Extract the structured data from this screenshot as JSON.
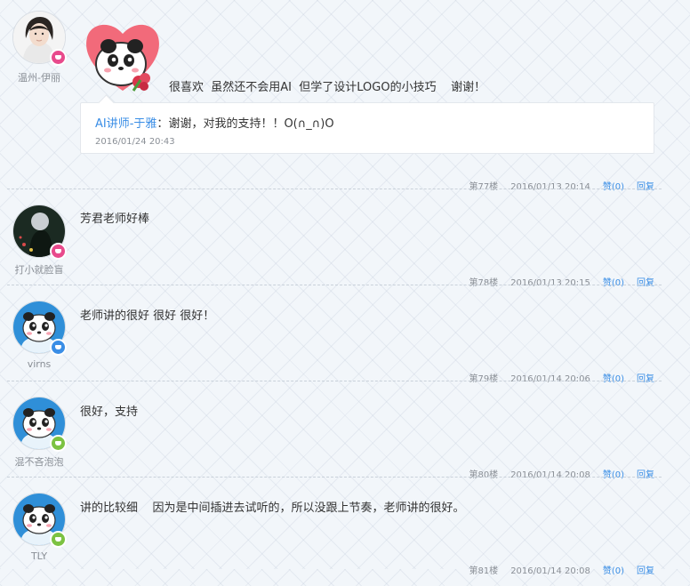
{
  "comments": [
    {
      "user": "温州-伊丽",
      "text": "很喜欢  虽然还不会用AI  但学了设计LOGO的小技巧    谢谢！",
      "floor": "第77楼",
      "date": "2016/01/13 20:14",
      "like": "赞(0)",
      "reply": "回复",
      "badge_color": "#e84a8c",
      "avatar_icon": "portrait-photo",
      "reply_box": {
        "name": "AI讲师-于雅",
        "sep": "：",
        "text": "谢谢，对我的支持！！O(∩_∩)O",
        "date": "2016/01/24 20:43"
      }
    },
    {
      "user": "打小就脸盲",
      "text": "芳君老师好棒",
      "floor": "第78楼",
      "date": "2016/01/13 20:15",
      "like": "赞(0)",
      "reply": "回复",
      "badge_color": "#e84a8c",
      "avatar_icon": "dark-photo"
    },
    {
      "user": "virns",
      "text": "老师讲的很好 很好 很好！",
      "floor": "第79楼",
      "date": "2016/01/14 20:06",
      "like": "赞(0)",
      "reply": "回复",
      "badge_color": "#3a8ee6",
      "avatar_icon": "panda-avatar"
    },
    {
      "user": "混不吝泡泡",
      "text": "很好，支持",
      "floor": "第80楼",
      "date": "2016/01/14 20:08",
      "like": "赞(0)",
      "reply": "回复",
      "badge_color": "#7cc242",
      "avatar_icon": "panda-avatar"
    },
    {
      "user": "TLY",
      "text": "讲的比较细    因为是中间插进去试听的，所以没跟上节奏，老师讲的很好。",
      "floor": "第81楼",
      "date": "2016/01/14 20:08",
      "like": "赞(0)",
      "reply": "回复",
      "badge_color": "#7cc242",
      "avatar_icon": "panda-avatar"
    }
  ],
  "colors": {
    "link": "#3a8ee6",
    "meta": "#8a8f96"
  },
  "sticker_icon": "panda-heart-flower-sticker"
}
